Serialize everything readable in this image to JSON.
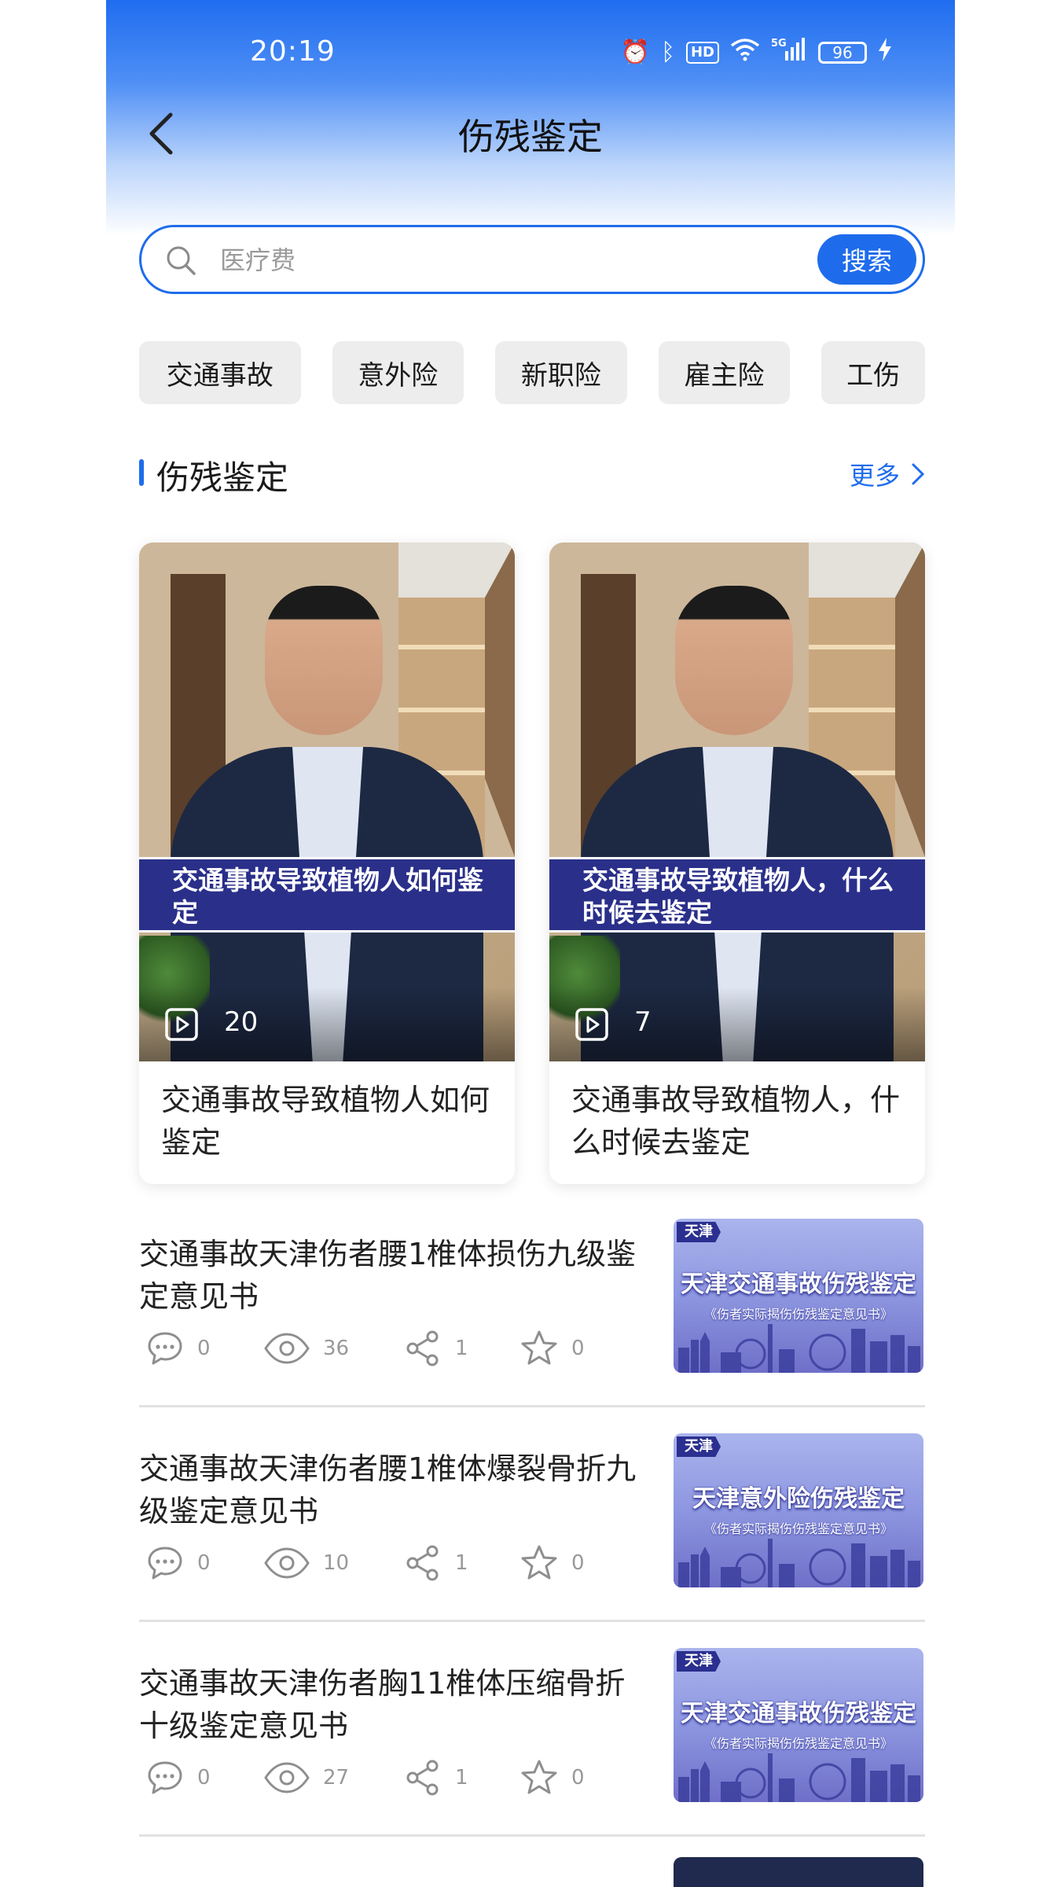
{
  "status_bar": {
    "time": "20:19",
    "signal": "5G",
    "battery": "96"
  },
  "nav": {
    "title": "伤残鉴定"
  },
  "search": {
    "placeholder": "医疗费",
    "button_label": "搜索"
  },
  "chips": [
    {
      "label": "交通事故"
    },
    {
      "label": "意外险"
    },
    {
      "label": "新职险"
    },
    {
      "label": "雇主险"
    },
    {
      "label": "工伤"
    }
  ],
  "section": {
    "title": "伤残鉴定",
    "more_label": "更多"
  },
  "videos": [
    {
      "banner": "交通事故导致植物人如何鉴定",
      "play_count": "20",
      "title": "交通事故导致植物人如何鉴定"
    },
    {
      "banner": "交通事故导致植物人，什么时候去鉴定",
      "play_count": "7",
      "title": "交通事故导致植物人，什么时候去鉴定"
    }
  ],
  "articles": [
    {
      "title": "交通事故天津伤者腰1椎体损伤九级鉴定意见书",
      "comments": "0",
      "views": "36",
      "shares": "1",
      "stars": "0",
      "thumb": {
        "tag": "天津",
        "headline": "天津交通事故伤残鉴定",
        "subtitle": "《伤者实际揭伤伤残鉴定意见书》"
      }
    },
    {
      "title": "交通事故天津伤者腰1椎体爆裂骨折九级鉴定意见书",
      "comments": "0",
      "views": "10",
      "shares": "1",
      "stars": "0",
      "thumb": {
        "tag": "天津",
        "headline": "天津意外险伤残鉴定",
        "subtitle": "《伤者实际揭伤伤残鉴定意见书》"
      }
    },
    {
      "title": "交通事故天津伤者胸11椎体压缩骨折十级鉴定意见书",
      "comments": "0",
      "views": "27",
      "shares": "1",
      "stars": "0",
      "thumb": {
        "tag": "天津",
        "headline": "天津交通事故伤残鉴定",
        "subtitle": "《伤者实际揭伤伤残鉴定意见书》"
      }
    }
  ],
  "colors": {
    "accent": "#1e6cec",
    "chip_bg": "#ededed",
    "banner_bg": "#2a2f8a"
  }
}
